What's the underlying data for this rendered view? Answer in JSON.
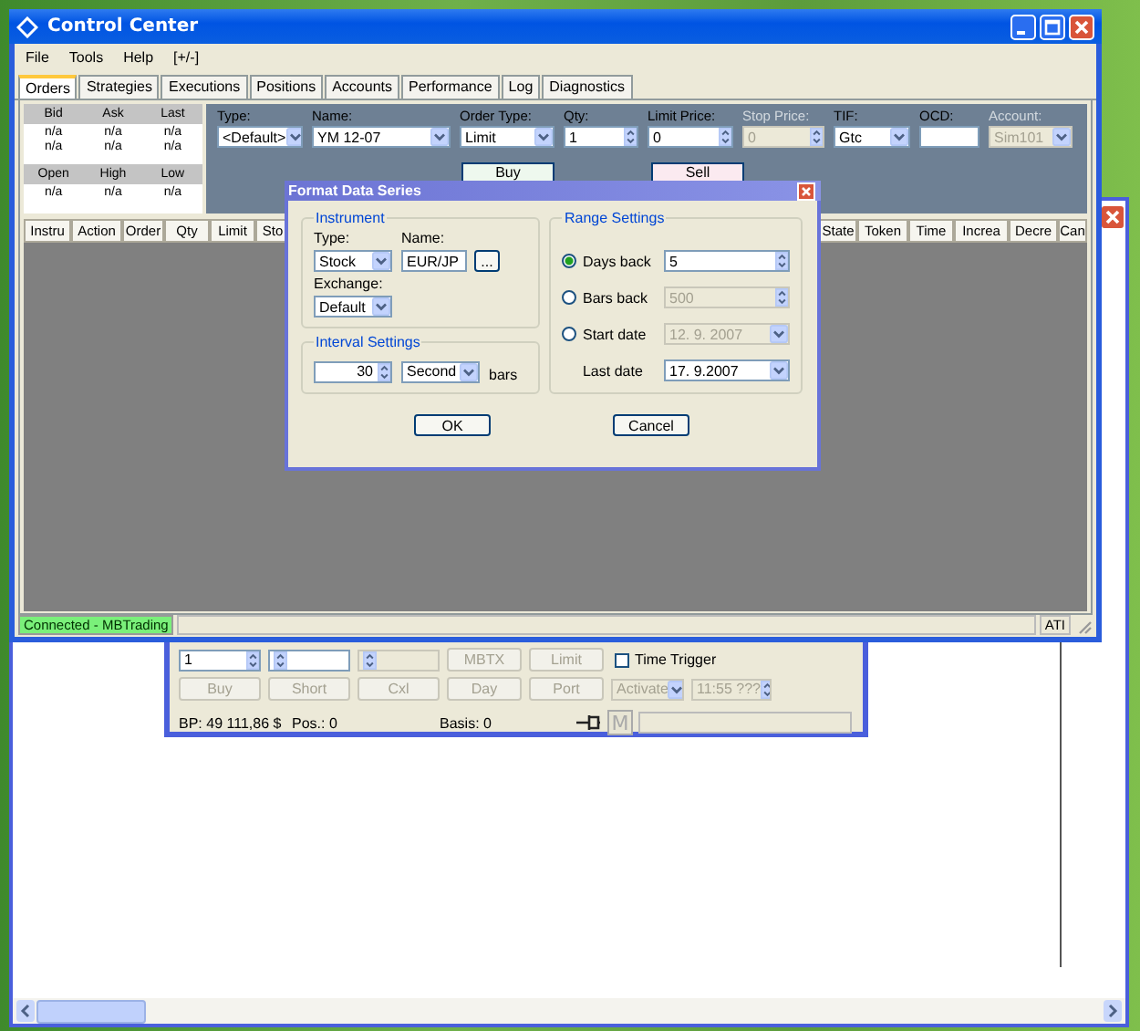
{
  "control_center": {
    "title": "Control Center",
    "menu": [
      "File",
      "Tools",
      "Help",
      "[+/-]"
    ],
    "tabs": [
      {
        "label": "Orders",
        "selected": true
      },
      {
        "label": "Strategies",
        "selected": false
      },
      {
        "label": "Executions",
        "selected": false
      },
      {
        "label": "Positions",
        "selected": false
      },
      {
        "label": "Accounts",
        "selected": false
      },
      {
        "label": "Performance",
        "selected": false
      },
      {
        "label": "Log",
        "selected": false
      },
      {
        "label": "Diagnostics",
        "selected": false
      }
    ],
    "quotes": {
      "header_1": [
        "Bid",
        "Ask",
        "Last"
      ],
      "rows_1": [
        [
          "n/a",
          "n/a",
          "n/a"
        ],
        [
          "n/a",
          "n/a",
          "n/a"
        ]
      ],
      "header_2": [
        "Open",
        "High",
        "Low"
      ],
      "rows_2": [
        [
          "n/a",
          "n/a",
          "n/a"
        ]
      ]
    },
    "order_fields": [
      {
        "label": "Type:",
        "kind": "dropdown",
        "value": "<Default>",
        "disabled": false
      },
      {
        "label": "Name:",
        "kind": "dropdown",
        "value": "YM 12-07",
        "disabled": false
      },
      {
        "label": "Order Type:",
        "kind": "dropdown",
        "value": "Limit",
        "disabled": false
      },
      {
        "label": "Qty:",
        "kind": "spin",
        "value": "1",
        "disabled": false
      },
      {
        "label": "Limit Price:",
        "kind": "spin",
        "value": "0",
        "disabled": false
      },
      {
        "label": "Stop Price:",
        "kind": "spin",
        "value": "0",
        "disabled": true
      },
      {
        "label": "TIF:",
        "kind": "dropdown",
        "value": "Gtc",
        "disabled": false
      },
      {
        "label": "OCD:",
        "kind": "text",
        "disabled": false
      },
      {
        "label": "Account:",
        "kind": "dropdown",
        "value": "Sim101",
        "disabled": true
      }
    ],
    "buy_button": "Buy",
    "sell_button": "Sell",
    "columns_left": [
      "Instru",
      "Action",
      "Order",
      "Qty",
      "Limit",
      "Sto"
    ],
    "columns_right": [
      "State",
      "Token",
      "Time",
      "Increa",
      "Decre",
      "Can"
    ],
    "status": "Connected - MBTrading",
    "status_right": "ATI"
  },
  "dialog": {
    "title": "Format Data Series",
    "instrument": {
      "title": "Instrument",
      "type_label": "Type:",
      "type": "Stock",
      "name_label": "Name:",
      "name": "EUR/JP",
      "browse": "...",
      "exchange_label": "Exchange:",
      "exchange": "Default"
    },
    "interval": {
      "title": "Interval Settings",
      "value": "30",
      "unit": "Second",
      "suffix": "bars"
    },
    "range": {
      "title": "Range Settings",
      "options": [
        {
          "label": "Days back",
          "selected": true,
          "kind": "spin",
          "value": "5",
          "disabled": false
        },
        {
          "label": "Bars back",
          "selected": false,
          "kind": "spin",
          "value": "500",
          "disabled": true
        },
        {
          "label": "Start date",
          "selected": false,
          "kind": "dropdown",
          "value": "12. 9. 2007",
          "disabled": true
        }
      ],
      "last_date_label": "Last date",
      "last_date": "17. 9.2007"
    },
    "buttons": [
      "OK",
      "Cancel"
    ]
  },
  "order_window": {
    "row_1": [
      {
        "kind": "spin",
        "value": "1",
        "disabled": false
      },
      {
        "kind": "spin",
        "disabled": false
      },
      {
        "kind": "spin",
        "disabled": true
      },
      {
        "kind": "button",
        "label": "MBTX",
        "disabled": true
      },
      {
        "kind": "button",
        "label": "Limit",
        "disabled": true
      },
      {
        "kind": "checkbox",
        "label": "Time Trigger",
        "checked": false,
        "disabled": false
      }
    ],
    "row_2": [
      {
        "kind": "button",
        "label": "Buy",
        "disabled": true
      },
      {
        "kind": "button",
        "label": "Short",
        "disabled": true
      },
      {
        "kind": "button",
        "label": "Cxl",
        "disabled": true
      },
      {
        "kind": "button",
        "label": "Day",
        "disabled": true
      },
      {
        "kind": "button",
        "label": "Port",
        "disabled": true
      },
      {
        "kind": "dropdown",
        "value": "Activate",
        "disabled": true
      },
      {
        "kind": "spin",
        "value": "11:55 ???",
        "disabled": true
      }
    ],
    "bp": "BP: 49 111,86 $",
    "pos": "Pos.: 0",
    "basis": "Basis: 0",
    "m_button": "M"
  }
}
